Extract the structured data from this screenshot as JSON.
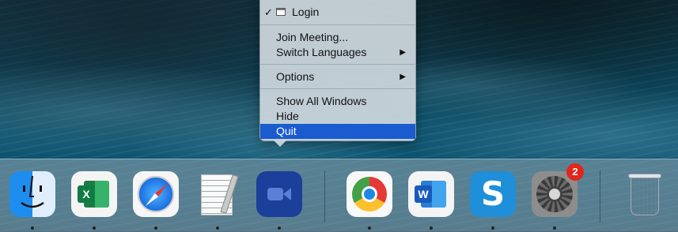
{
  "menu": {
    "items": [
      {
        "label": "Login",
        "checked": true
      },
      {
        "label": "Join Meeting..."
      },
      {
        "label": "Switch Languages",
        "submenu": true
      },
      {
        "label": "Options",
        "submenu": true
      },
      {
        "label": "Show All Windows"
      },
      {
        "label": "Hide"
      },
      {
        "label": "Quit",
        "selected": true
      }
    ],
    "check_glyph": "✓",
    "submenu_glyph": "▶"
  },
  "dock": {
    "apps": [
      {
        "name": "Finder",
        "icon": "finder-icon",
        "running": true
      },
      {
        "name": "Microsoft Excel",
        "icon": "excel-icon",
        "running": true
      },
      {
        "name": "Safari",
        "icon": "safari-icon",
        "running": true
      },
      {
        "name": "TextEdit",
        "icon": "textedit-icon",
        "running": true
      },
      {
        "name": "Zoom",
        "icon": "zoom-icon",
        "running": true
      },
      {
        "name": "Google Chrome",
        "icon": "chrome-icon",
        "running": true
      },
      {
        "name": "Microsoft Word",
        "icon": "word-icon",
        "running": true
      },
      {
        "name": "Snagit",
        "icon": "snagit-icon",
        "running": true
      },
      {
        "name": "System Preferences",
        "icon": "system-preferences-icon",
        "running": true,
        "badge": "2"
      },
      {
        "name": "Trash",
        "icon": "trash-icon",
        "running": false
      }
    ],
    "letters": {
      "excel": "X",
      "word": "W",
      "snagit": "S"
    }
  },
  "colors": {
    "menu_highlight": "#1a5bd0",
    "badge": "#e0271c"
  }
}
